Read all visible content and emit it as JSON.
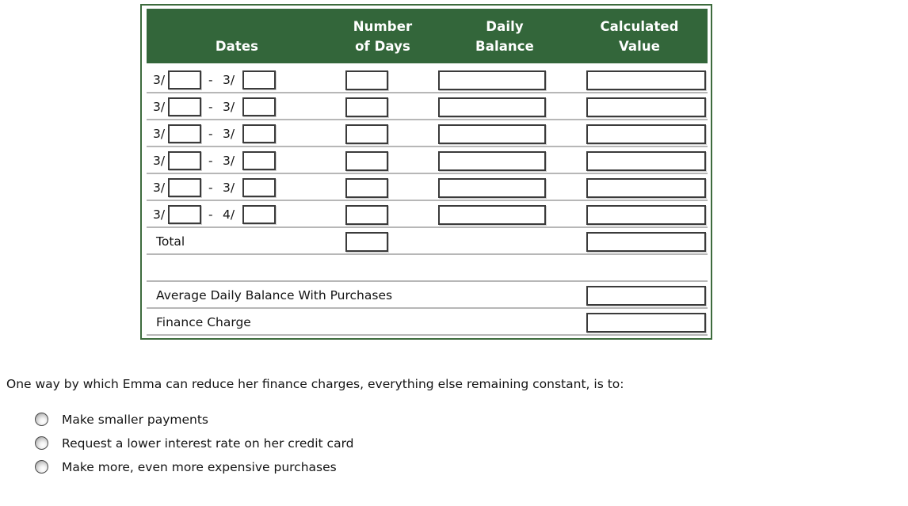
{
  "worksheet": {
    "headers": {
      "dates": {
        "line1": "",
        "line2": "Dates"
      },
      "number_of_days": {
        "line1": "Number",
        "line2": "of Days"
      },
      "daily_balance": {
        "line1": "Daily",
        "line2": "Balance"
      },
      "calculated_value": {
        "line1": "Calculated",
        "line2": "Value"
      }
    },
    "accent_color": "#33663a",
    "rows": [
      {
        "start_month": "3/",
        "start_day": "",
        "dash": "-",
        "end_month": "3/",
        "end_day": "",
        "days": "",
        "balance": "",
        "calculated": ""
      },
      {
        "start_month": "3/",
        "start_day": "",
        "dash": "-",
        "end_month": "3/",
        "end_day": "",
        "days": "",
        "balance": "",
        "calculated": ""
      },
      {
        "start_month": "3/",
        "start_day": "",
        "dash": "-",
        "end_month": "3/",
        "end_day": "",
        "days": "",
        "balance": "",
        "calculated": ""
      },
      {
        "start_month": "3/",
        "start_day": "",
        "dash": "-",
        "end_month": "3/",
        "end_day": "",
        "days": "",
        "balance": "",
        "calculated": ""
      },
      {
        "start_month": "3/",
        "start_day": "",
        "dash": "-",
        "end_month": "3/",
        "end_day": "",
        "days": "",
        "balance": "",
        "calculated": ""
      },
      {
        "start_month": "3/",
        "start_day": "",
        "dash": "-",
        "end_month": "4/",
        "end_day": "",
        "days": "",
        "balance": "",
        "calculated": ""
      }
    ],
    "total_row": {
      "label": "Total",
      "days": "",
      "calculated": ""
    },
    "summary_rows": [
      {
        "label": "Average Daily Balance With Purchases",
        "value": ""
      },
      {
        "label": "Finance Charge",
        "value": ""
      }
    ]
  },
  "question": {
    "prompt": "One way by which Emma can reduce her finance charges, everything else remaining constant, is to:",
    "options": [
      {
        "label": "Make smaller payments",
        "selected": false
      },
      {
        "label": "Request a lower interest rate on her credit card",
        "selected": false
      },
      {
        "label": "Make more, even more expensive purchases",
        "selected": false
      }
    ]
  }
}
